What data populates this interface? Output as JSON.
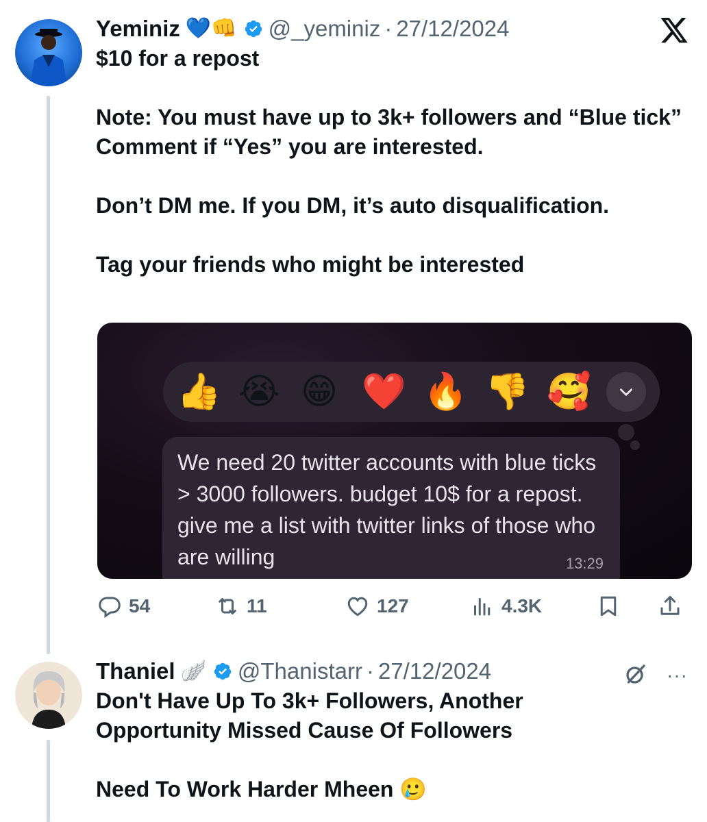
{
  "tweet1": {
    "name": "Yeminiz",
    "badges": "💙👊",
    "handle": "@_yeminiz",
    "separator": "·",
    "date": "27/12/2024",
    "lines": [
      "$10 for a repost",
      "",
      "Note: You must have up to 3k+ followers and “Blue tick”",
      "Comment if “Yes” you are interested.",
      "",
      "Don’t DM me. If you DM, it’s auto disqualification.",
      "",
      "Tag your friends who might be interested"
    ],
    "media": {
      "reactions": [
        "👍",
        "😭",
        "😁",
        "❤️",
        "🔥",
        "👎",
        "🥰"
      ],
      "message": "We need 20 twitter accounts with blue ticks > 3000 followers. budget 10$ for a repost. give me a list with twitter links of those who are willing",
      "time": "13:29"
    },
    "actions": {
      "replies": "54",
      "reposts": "11",
      "likes": "127",
      "views": "4.3K"
    }
  },
  "tweet2": {
    "name": "Thaniel",
    "badges": "🪽",
    "handle": "@Thanistarr",
    "separator": "·",
    "date": "27/12/2024",
    "lines": [
      "Don't Have Up To 3k+ Followers, Another Opportunity Missed Cause Of Followers",
      "",
      "Need To Work Harder Mheen 🥲"
    ],
    "more": "···"
  },
  "colors": {
    "verified": "#1d9bf0",
    "secondary_text": "#536471",
    "thread_line": "#cfd9de"
  }
}
